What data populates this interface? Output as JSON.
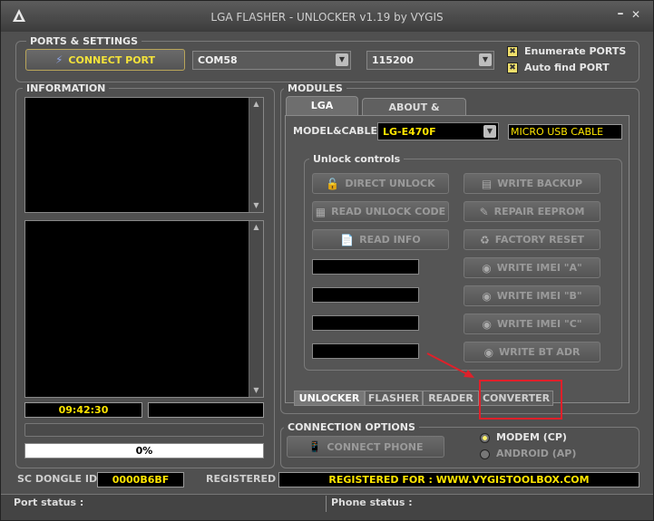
{
  "window": {
    "title": "LGA FLASHER - UNLOCKER v1.19  by VYGIS",
    "min": "–",
    "close": "✕"
  },
  "ports": {
    "group_title": "PORTS & SETTINGS",
    "connect_label": "CONNECT PORT",
    "port_value": "COM58",
    "baud_value": "115200",
    "enumerate_label": "Enumerate PORTS",
    "autofind_label": "Auto find PORT"
  },
  "information": {
    "group_title": "INFORMATION",
    "time": "09:42:30",
    "progress_text": "0%",
    "progress": 0
  },
  "modules": {
    "group_title": "MODULES",
    "tabs": [
      "LGA",
      "ABOUT & SUPPORT"
    ],
    "model_label": "MODEL&CABLE :",
    "model_value": "LG-E470F",
    "cable_value": "MICRO USB CABLE",
    "unlock_title": "Unlock controls",
    "buttons": {
      "direct_unlock": "DIRECT UNLOCK",
      "read_unlock_code": "READ UNLOCK CODE",
      "read_info": "READ INFO",
      "write_backup": "WRITE BACKUP",
      "repair_eeprom": "REPAIR EEPROM",
      "factory_reset": "FACTORY RESET",
      "write_imei_a": "WRITE IMEI \"A\"",
      "write_imei_b": "WRITE IMEI \"B\"",
      "write_imei_c": "WRITE IMEI \"C\"",
      "write_bt_adr": "WRITE BT ADR"
    },
    "bottom_tabs": [
      "UNLOCKER",
      "FLASHER",
      "READER",
      "CONVERTER"
    ]
  },
  "connection": {
    "group_title": "CONNECTION OPTIONS",
    "connect_phone_label": "CONNECT PHONE",
    "modem_label": "MODEM (CP)",
    "android_label": "ANDROID (AP)"
  },
  "footer": {
    "dongle_label": "SC DONGLE ID :",
    "dongle_value": "0000B6BF",
    "registered_label": "REGISTERED :",
    "registered_value": "REGISTERED FOR : WWW.VYGISTOOLBOX.COM",
    "port_status": "Port status :",
    "phone_status": "Phone status :"
  },
  "colors": {
    "highlight_box": "#e0202a",
    "arrow": "#e0202a",
    "field_text": "#ffe600"
  },
  "icons": [
    "app-icon",
    "plug-icon",
    "unlock-icon",
    "backup-icon",
    "keypad-icon",
    "repair-icon",
    "notepad-icon",
    "reset-icon",
    "imei-icon",
    "phone-cable-icon"
  ]
}
